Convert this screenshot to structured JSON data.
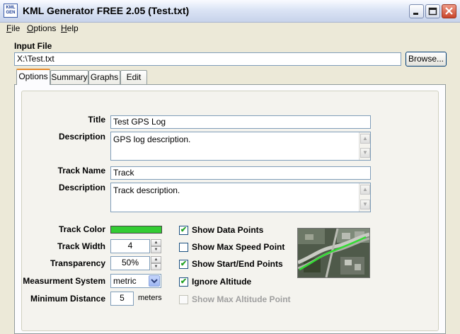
{
  "window": {
    "title": "KML Generator FREE 2.05 (Test.txt)",
    "icon_text_top": "KML",
    "icon_text_bottom": "GEN"
  },
  "menu": {
    "items": [
      {
        "label": "File",
        "accel": "F"
      },
      {
        "label": "Options",
        "accel": "O"
      },
      {
        "label": "Help",
        "accel": "H"
      }
    ]
  },
  "input_file": {
    "label": "Input File",
    "value": "X:\\Test.txt",
    "browse_label": "Browse..."
  },
  "tabs": [
    {
      "label": "Options",
      "active": true
    },
    {
      "label": "Summary",
      "active": false
    },
    {
      "label": "Graphs",
      "active": false
    },
    {
      "label": "Edit",
      "active": false
    }
  ],
  "form": {
    "title_label": "Title",
    "title_value": "Test GPS Log",
    "description_label": "Description",
    "description_value": "GPS log description.",
    "track_name_label": "Track Name",
    "track_name_value": "Track",
    "track_description_label": "Description",
    "track_description_value": "Track description.",
    "track_color_label": "Track Color",
    "track_color": "#33cc33",
    "track_width_label": "Track Width",
    "track_width_value": "4",
    "transparency_label": "Transparency",
    "transparency_value": "50%",
    "measurement_label": "Measurment System",
    "measurement_value": "metric",
    "min_distance_label": "Minimum Distance",
    "min_distance_value": "5",
    "min_distance_unit": "meters"
  },
  "checkboxes": [
    {
      "label": "Show Data Points",
      "checked": true,
      "enabled": true
    },
    {
      "label": "Show Max Speed Point",
      "checked": false,
      "enabled": true
    },
    {
      "label": "Show Start/End Points",
      "checked": true,
      "enabled": true
    },
    {
      "label": "Ignore Altitude",
      "checked": true,
      "enabled": true
    },
    {
      "label": "Show Max Altitude Point",
      "checked": false,
      "enabled": false
    }
  ],
  "colors": {
    "title_gradient": "#dbe4f5",
    "close_button": "#c9452b",
    "tab_accent": "#e68b2c",
    "checkmark": "#21a121"
  }
}
